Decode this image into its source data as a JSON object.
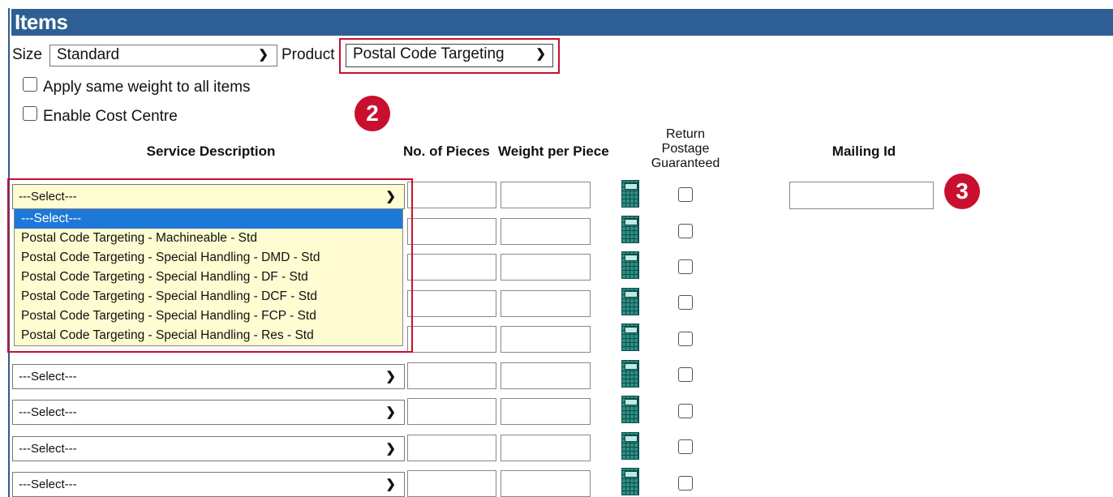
{
  "section": {
    "title": "Items"
  },
  "filters": {
    "size_label": "Size",
    "size_value": "Standard",
    "product_label": "Product",
    "product_value": "Postal Code Targeting"
  },
  "options": {
    "apply_weight_label": "Apply same weight to all items",
    "cost_centre_label": "Enable Cost Centre"
  },
  "badges": {
    "two": "2",
    "three": "3"
  },
  "table": {
    "headers": {
      "service": "Service Description",
      "pieces": "No. of Pieces",
      "weight": "Weight per Piece",
      "return_line1": "Return",
      "return_line2": "Postage",
      "return_line3": "Guaranteed",
      "mailing": "Mailing Id"
    },
    "select_placeholder": "---Select---"
  },
  "dropdown": {
    "options": [
      "---Select---",
      "Postal Code Targeting - Machineable - Std",
      "Postal Code Targeting - Special Handling - DMD - Std",
      "Postal Code Targeting - Special Handling - DF - Std",
      "Postal Code Targeting - Special Handling - DCF - Std",
      "Postal Code Targeting - Special Handling - FCP - Std",
      "Postal Code Targeting - Special Handling - Res - Std"
    ],
    "selected": "---Select---"
  },
  "rows": [
    {
      "service": "---Select---"
    },
    {
      "service": "---Select---"
    },
    {
      "service": "---Select---"
    },
    {
      "service": "---Select---"
    },
    {
      "service": "---Select---"
    },
    {
      "service": "---Select---"
    },
    {
      "service": "---Select---"
    },
    {
      "service": "---Select---"
    },
    {
      "service": "---Select---"
    }
  ],
  "colors": {
    "header_bar": "#2d5f94",
    "highlight": "#c8102e",
    "dropdown_bg": "#fffcd2",
    "selection": "#1e78d7"
  }
}
